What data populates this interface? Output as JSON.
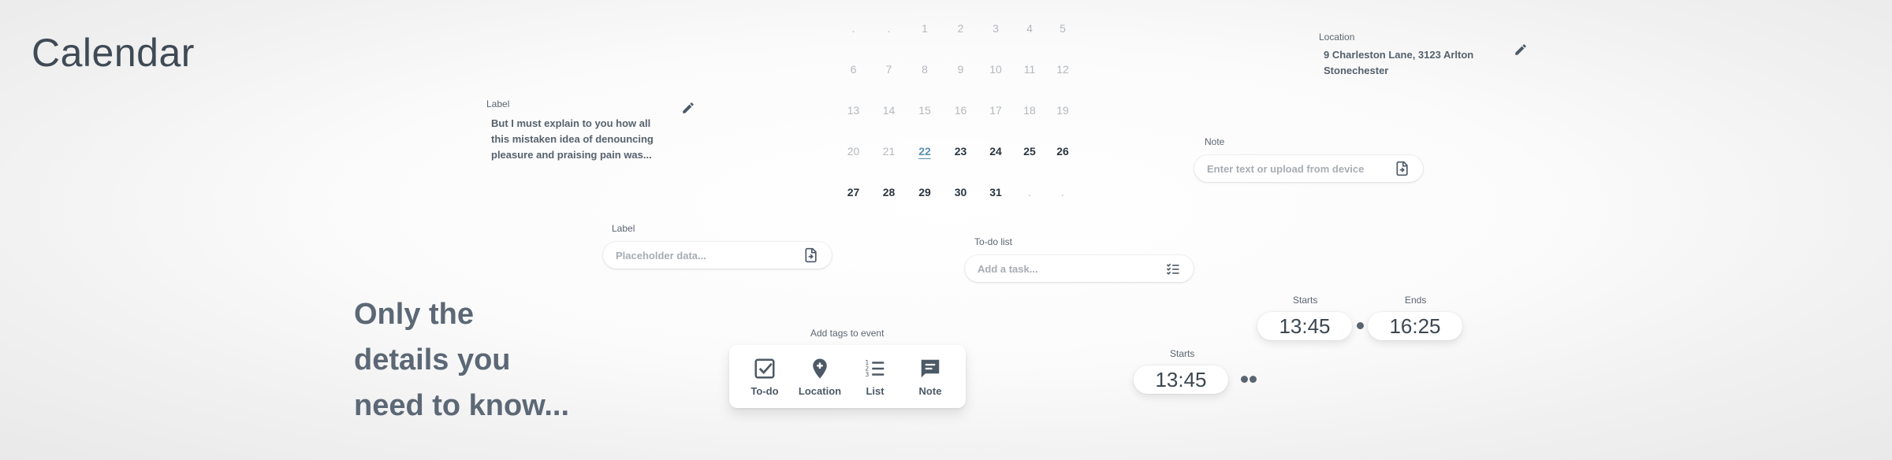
{
  "page": {
    "title": "Calendar"
  },
  "tagline": {
    "line1": "Only the",
    "line2": "details you",
    "line3": "need to know..."
  },
  "label_card": {
    "label": "Label",
    "line1": "But I must explain to you how all",
    "line2": "this mistaken idea of denouncing",
    "line3": "pleasure and praising pain was..."
  },
  "label_input": {
    "label": "Label",
    "placeholder": "Placeholder data..."
  },
  "calendar": {
    "weeks": [
      [
        ".",
        ".",
        "1",
        "2",
        "3",
        "4",
        "5"
      ],
      [
        "6",
        "7",
        "8",
        "9",
        "10",
        "11",
        "12"
      ],
      [
        "13",
        "14",
        "15",
        "16",
        "17",
        "18",
        "19"
      ],
      [
        "20",
        "21",
        "22",
        "23",
        "24",
        "25",
        "26"
      ],
      [
        "27",
        "28",
        "29",
        "30",
        "31",
        ".",
        "."
      ]
    ],
    "today": "22"
  },
  "todo": {
    "label": "To-do list",
    "placeholder": "Add a task..."
  },
  "location": {
    "label": "Location",
    "line1": "9 Charleston Lane, 3123 Arlton",
    "line2": "Stonechester"
  },
  "note": {
    "label": "Note",
    "placeholder": "Enter text or upload from device"
  },
  "tags": {
    "title": "Add tags to event",
    "items": [
      {
        "label": "To-do",
        "icon": "checkbox-icon"
      },
      {
        "label": "Location",
        "icon": "location-pin-icon"
      },
      {
        "label": "List",
        "icon": "numbered-list-icon"
      },
      {
        "label": "Note",
        "icon": "note-icon"
      }
    ]
  },
  "time_range": {
    "starts_label": "Starts",
    "starts": "13:45",
    "ends_label": "Ends",
    "ends": "16:25"
  },
  "time_single": {
    "starts_label": "Starts",
    "starts": "13:45"
  },
  "colors": {
    "text": "#4c5966",
    "today": "#5a8fb3",
    "muted": "#b3b8bd"
  }
}
